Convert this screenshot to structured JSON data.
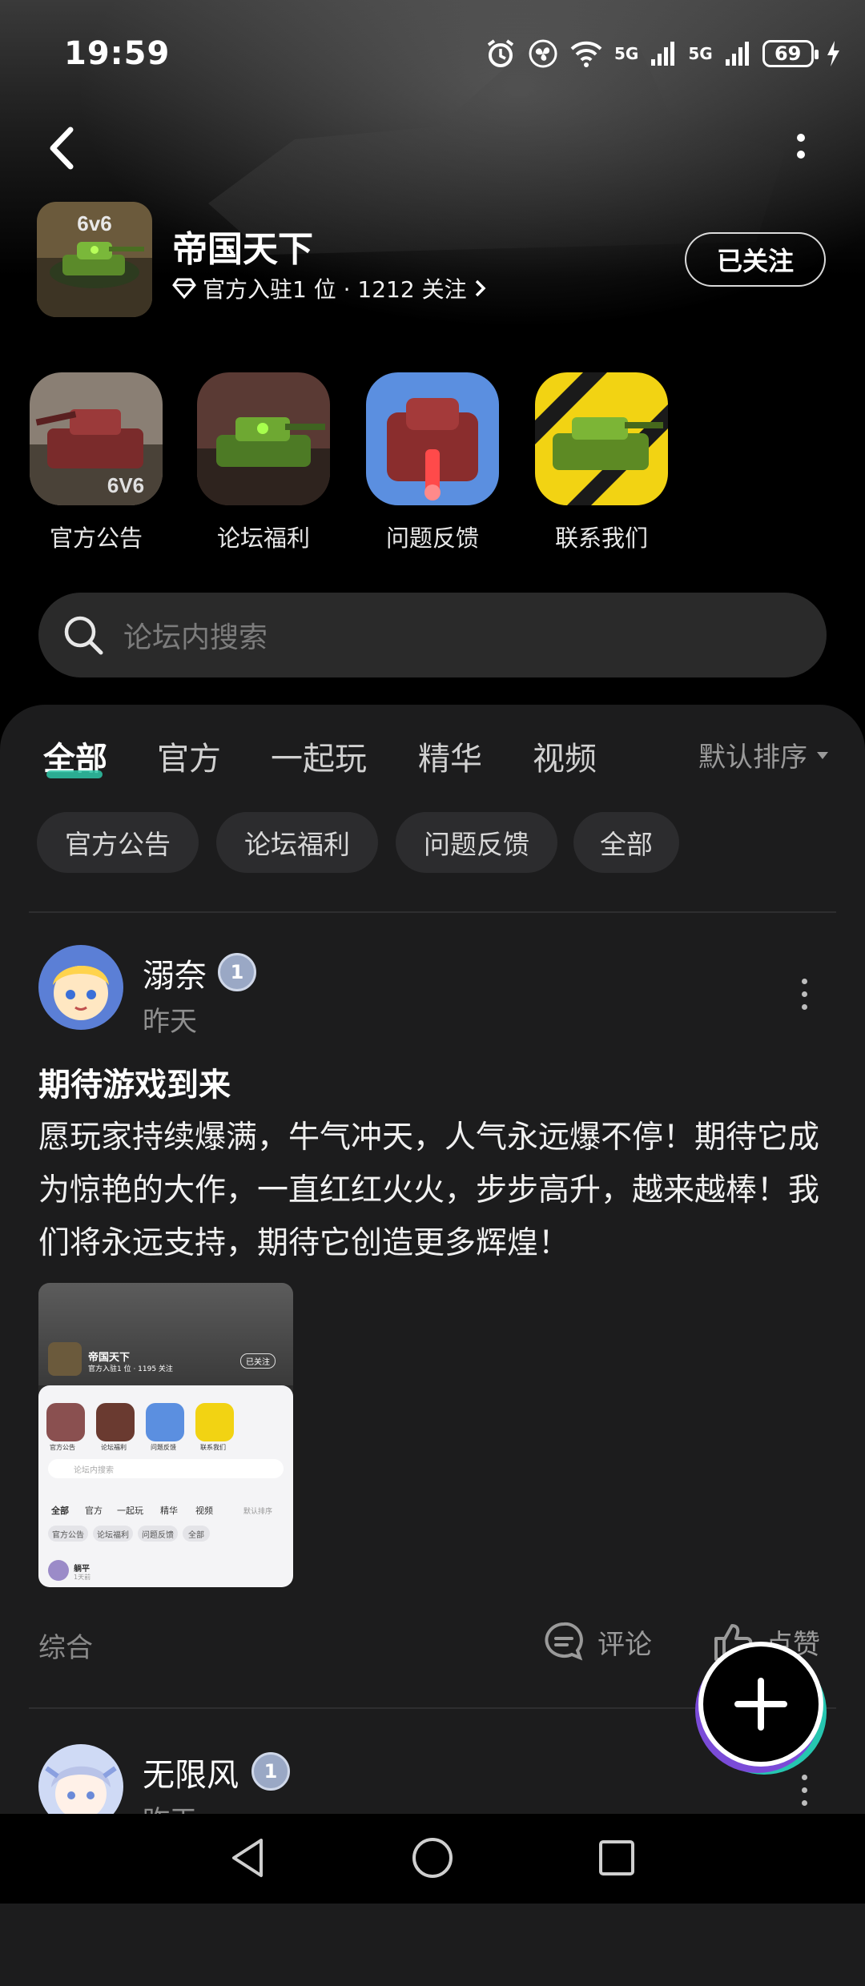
{
  "status_bar": {
    "time": "19:59",
    "network_1": "5G",
    "network_2": "5G",
    "battery": "69"
  },
  "forum": {
    "title": "帝国天下",
    "meta": "官方入驻1 位 · 1212 关注",
    "follow_label": "已关注",
    "avatar_badge": "6v6"
  },
  "shortcuts": [
    {
      "label": "官方公告",
      "badge": "6V6"
    },
    {
      "label": "论坛福利"
    },
    {
      "label": "问题反馈"
    },
    {
      "label": "联系我们"
    }
  ],
  "search": {
    "placeholder": "论坛内搜索"
  },
  "tabs": [
    {
      "label": "全部",
      "active": true
    },
    {
      "label": "官方"
    },
    {
      "label": "一起玩"
    },
    {
      "label": "精华"
    },
    {
      "label": "视频"
    }
  ],
  "sort": {
    "label": "默认排序"
  },
  "chips": [
    "官方公告",
    "论坛福利",
    "问题反馈",
    "全部"
  ],
  "posts": [
    {
      "author": "溺奈",
      "level": "1",
      "time": "昨天",
      "title": "期待游戏到来",
      "body": "愿玩家持续爆满，牛气冲天，人气永远爆不停！期待它成为惊艳的大作，一直红红火火，步步高升，越来越棒！我们将永远支持，期待它创造更多辉煌！",
      "category": "综合",
      "comment_label": "评论",
      "like_label": "点赞",
      "image": {
        "title": "帝国天下",
        "meta": "官方入驻1 位 · 1195 关注",
        "follow": "已关注",
        "search": "论坛内搜索",
        "tabs": [
          "全部",
          "官方",
          "一起玩",
          "精华",
          "视频"
        ],
        "sort": "默认排序",
        "chips": [
          "官方公告",
          "论坛福利",
          "问题反馈",
          "全部"
        ],
        "icons": [
          "官方公告",
          "论坛福利",
          "问题反馈",
          "联系我们"
        ],
        "author": "躺平",
        "time": "1天前"
      }
    },
    {
      "author": "无限风",
      "level": "1",
      "time": "昨天"
    }
  ],
  "colors": {
    "accent": "#2ec5a7",
    "panel": "#1c1c1d",
    "chip": "#2c2c2e"
  }
}
